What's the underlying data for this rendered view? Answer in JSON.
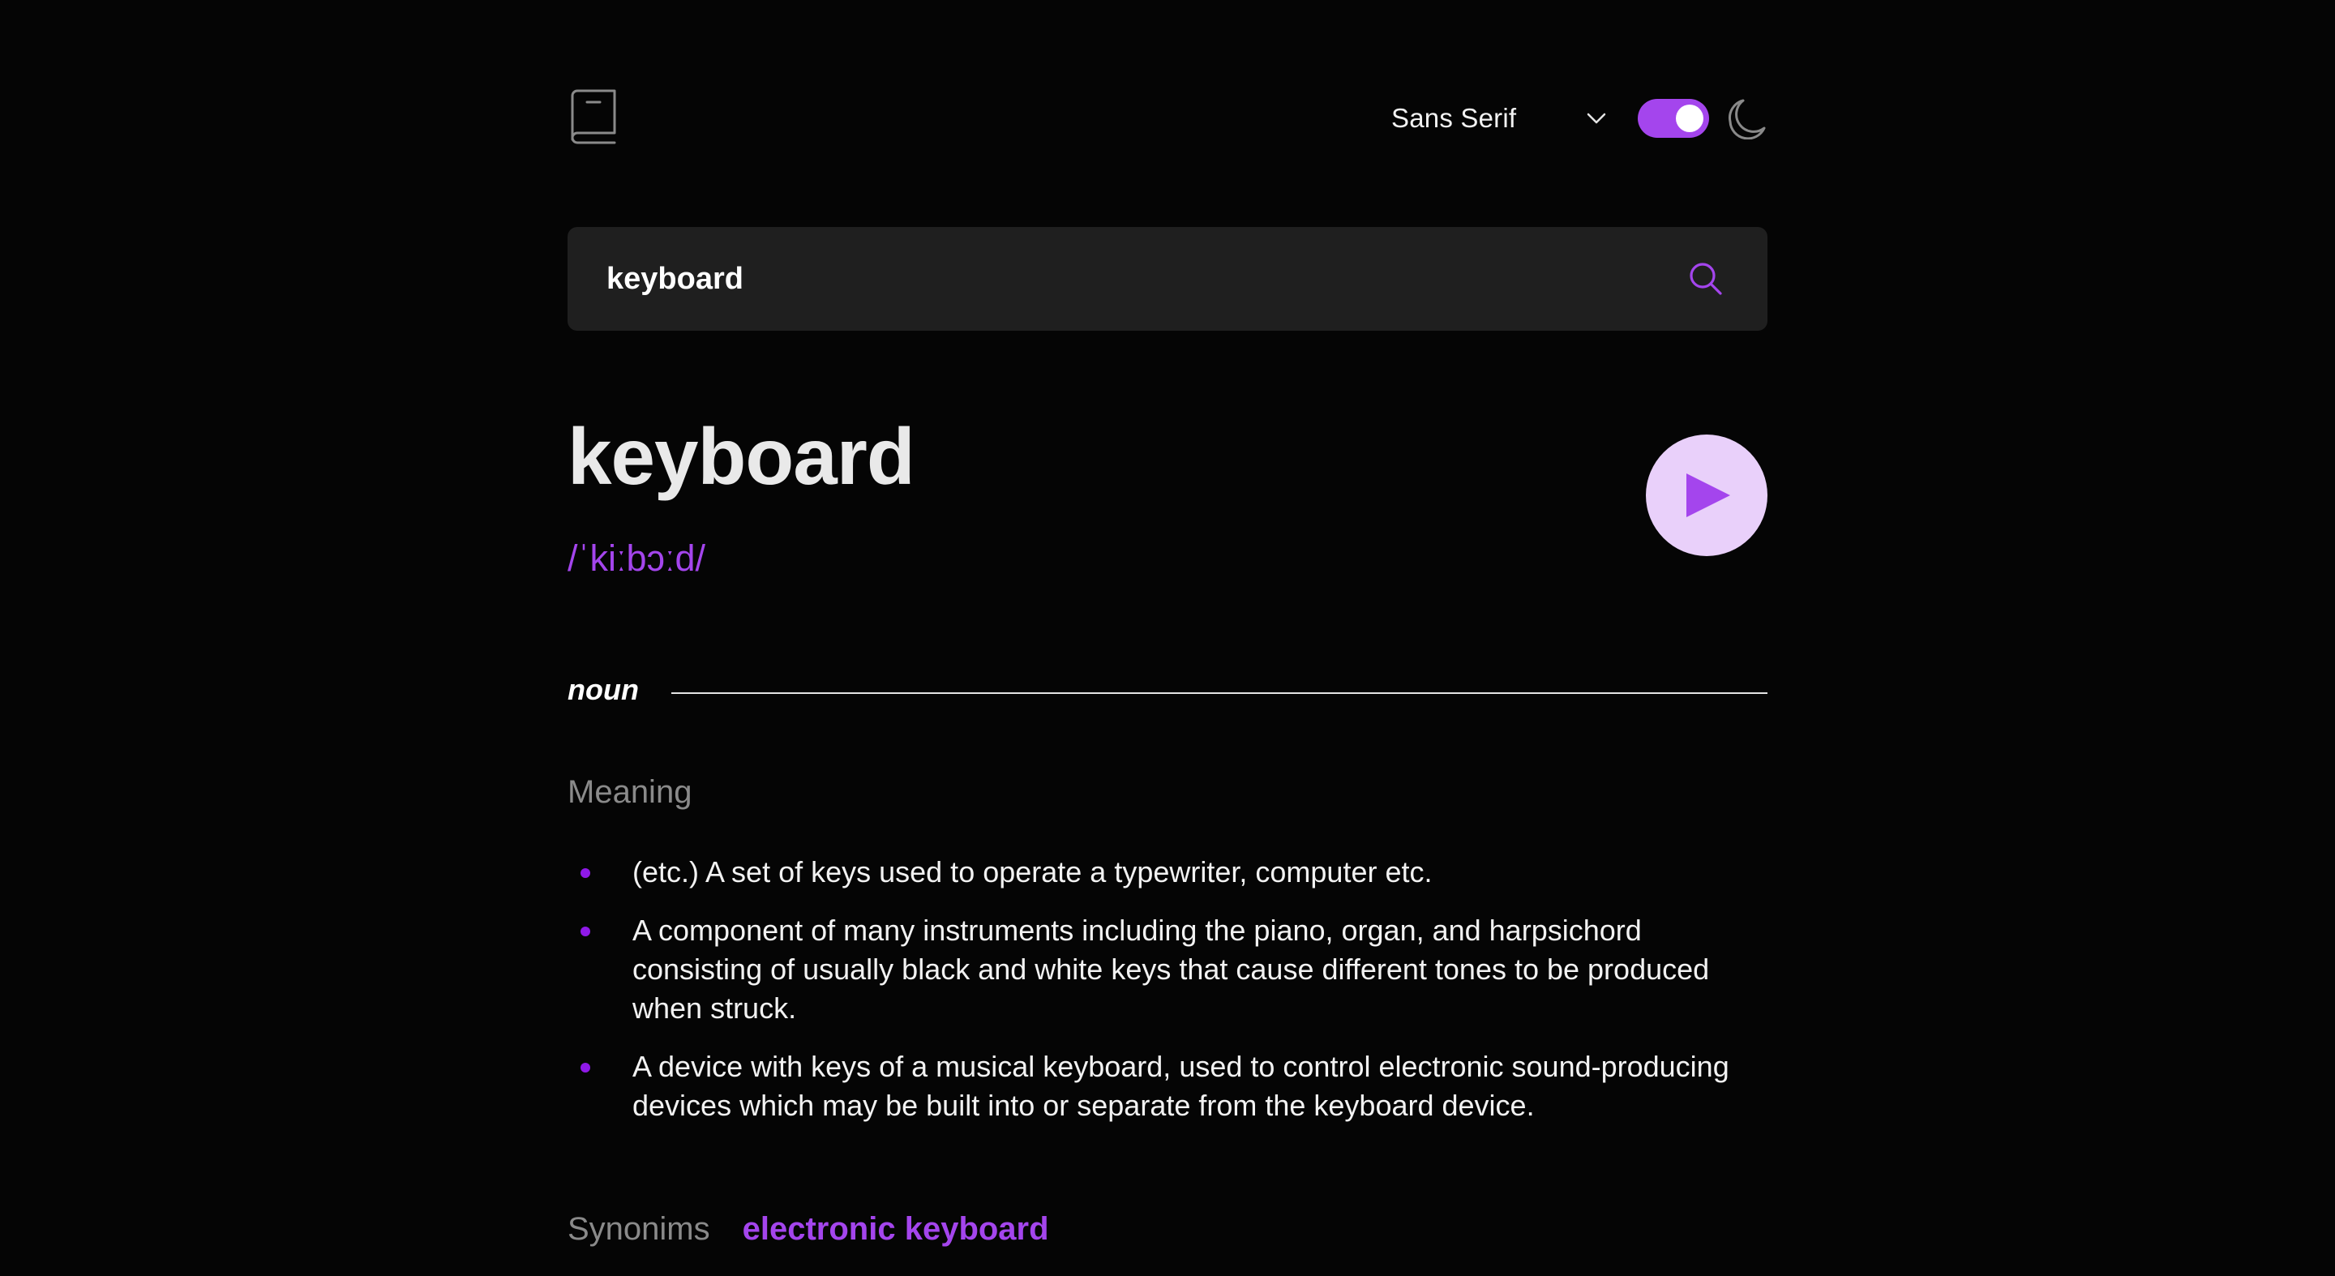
{
  "header": {
    "font_selected": "Sans Serif",
    "theme_dark": true
  },
  "search": {
    "value": "keyboard",
    "placeholder": ""
  },
  "entry": {
    "word": "keyboard",
    "phonetic": "/ˈkiːbɔːd/",
    "part_of_speech": "noun",
    "meaning_heading": "Meaning",
    "definitions": [
      "(etc.) A set of keys used to operate a typewriter, computer etc.",
      "A component of many instruments including the piano, organ, and harpsichord consisting of usually black and white keys that cause different tones to be produced when struck.",
      "A device with keys of a musical keyboard, used to control electronic sound-producing devices which may be built into or separate from the keyboard device."
    ],
    "synonyms_label": "Synonims",
    "synonyms": [
      "electronic keyboard"
    ]
  },
  "colors": {
    "accent": "#a445ed",
    "background": "#050505",
    "search_bg": "#1f1f1f",
    "play_bg": "#e9d0fa"
  },
  "icons": {
    "logo": "book-icon",
    "dropdown": "chevron-down-icon",
    "theme": "moon-icon",
    "search": "search-icon",
    "play": "play-icon"
  }
}
